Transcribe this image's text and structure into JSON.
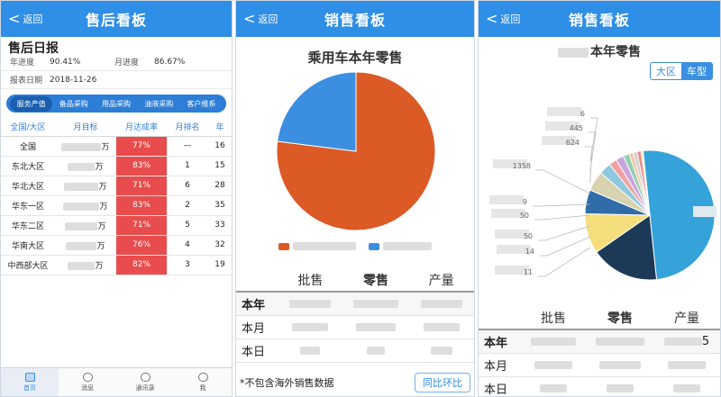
{
  "panel1": {
    "header": {
      "back": "返回",
      "title": "售后看板"
    },
    "daily_title": "售后日报",
    "year_progress_label": "年进度",
    "year_progress_value": "90.41%",
    "month_progress_label": "月进度",
    "month_progress_value": "86.67%",
    "report_date_label": "报表日期",
    "report_date_value": "2018-11-26",
    "tabs": [
      "服务产值",
      "备品采购",
      "用品采购",
      "油液采购",
      "客户维系"
    ],
    "table": {
      "headers": [
        "全国/大区",
        "月目标",
        "月达成率",
        "月排名",
        "年"
      ],
      "rows": [
        {
          "region": "全国",
          "unit": "万",
          "rate": "77%",
          "rank": "—",
          "year": "16"
        },
        {
          "region": "东北大区",
          "unit": "万",
          "rate": "83%",
          "rank": "1",
          "year": "15"
        },
        {
          "region": "华北大区",
          "unit": "万",
          "rate": "71%",
          "rank": "6",
          "year": "28"
        },
        {
          "region": "华东一区",
          "unit": "万",
          "rate": "83%",
          "rank": "2",
          "year": "35"
        },
        {
          "region": "华东二区",
          "unit": "万",
          "rate": "71%",
          "rank": "5",
          "year": "33"
        },
        {
          "region": "华南大区",
          "unit": "万",
          "rate": "76%",
          "rank": "4",
          "year": "32"
        },
        {
          "region": "中西部大区",
          "unit": "万",
          "rate": "82%",
          "rank": "3",
          "year": "19"
        }
      ]
    },
    "tabbar": [
      "首页",
      "消息",
      "通讯录",
      "我"
    ]
  },
  "panel2": {
    "header": {
      "back": "返回",
      "title": "销售看板"
    },
    "chart_title": "乘用车本年零售",
    "chart_data": {
      "type": "pie",
      "title": "乘用车本年零售",
      "slices": [
        {
          "value": 77,
          "color": "#db5a26"
        },
        {
          "value": 23,
          "color": "#3b8ee0"
        }
      ]
    },
    "columns": [
      "批售",
      "零售",
      "产量"
    ],
    "rows": [
      "本年",
      "本月",
      "本日"
    ],
    "footnote": "*不包含海外销售数据",
    "yoy_button": "同比环比"
  },
  "panel3": {
    "header": {
      "back": "返回",
      "title": "销售看板"
    },
    "chart_title": "本年零售",
    "toggle": [
      "大区",
      "车型"
    ],
    "chart_data": {
      "type": "pie",
      "title": "本年零售",
      "slices": [
        {
          "value": 50,
          "color": "#35a3d9"
        },
        {
          "value": 17,
          "color": "#1c3a57"
        },
        {
          "value": 10,
          "color": "#f5df7d"
        },
        {
          "value": 6,
          "color": "#2f6ca8"
        },
        {
          "value": 5,
          "color": "#d9d2b0"
        },
        {
          "value": 3,
          "color": "#8fc8df"
        },
        {
          "value": 2,
          "color": "#efa2a2"
        },
        {
          "value": 2,
          "color": "#c9a4dd"
        },
        {
          "value": 1.5,
          "color": "#95ccb0"
        },
        {
          "value": 1,
          "color": "#f0c3a0"
        },
        {
          "value": 1,
          "color": "#cfcfcf"
        },
        {
          "value": 1,
          "color": "#ee8b8b"
        },
        {
          "value": 0.5,
          "color": "#f3f09f"
        }
      ],
      "callouts": [
        "6",
        "445",
        "624",
        "1358",
        "9",
        "50",
        "50",
        "14",
        "11"
      ]
    },
    "columns": [
      "批售",
      "零售",
      "产量"
    ],
    "rows": [
      "本年",
      "本月",
      "本日"
    ],
    "partial_digit": "5"
  }
}
